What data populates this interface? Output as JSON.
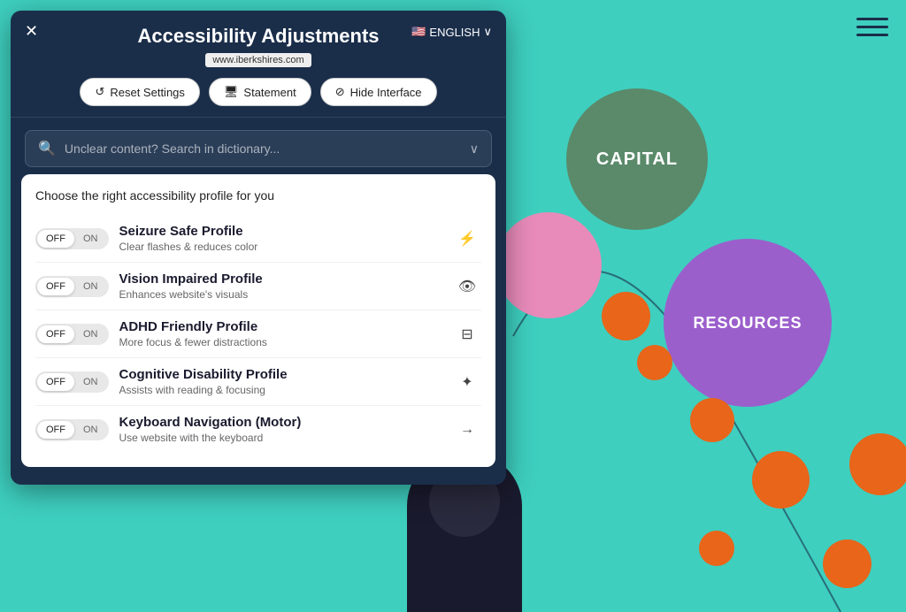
{
  "panel": {
    "title": "Accessibility Adjustments",
    "url": "www.iberkshires.com",
    "close_label": "✕",
    "language_label": "ENGLISH",
    "language_flag": "🇺🇸"
  },
  "action_buttons": {
    "reset": "Reset Settings",
    "statement": "Statement",
    "hide": "Hide Interface"
  },
  "search": {
    "placeholder": "Unclear content? Search in dictionary..."
  },
  "profile_section": {
    "heading": "Choose the right accessibility profile for you",
    "profiles": [
      {
        "name": "Seizure Safe Profile",
        "desc": "Clear flashes & reduces color",
        "icon": "⚡",
        "off_label": "OFF",
        "on_label": "ON",
        "active": "off"
      },
      {
        "name": "Vision Impaired Profile",
        "desc": "Enhances website's visuals",
        "icon": "👁",
        "off_label": "OFF",
        "on_label": "ON",
        "active": "off"
      },
      {
        "name": "ADHD Friendly Profile",
        "desc": "More focus & fewer distractions",
        "icon": "⊟",
        "off_label": "OFF",
        "on_label": "ON",
        "active": "off"
      },
      {
        "name": "Cognitive Disability Profile",
        "desc": "Assists with reading & focusing",
        "icon": "✦",
        "off_label": "OFF",
        "on_label": "ON",
        "active": "off"
      },
      {
        "name": "Keyboard Navigation (Motor)",
        "desc": "Use website with the keyboard",
        "icon": "→",
        "off_label": "OFF",
        "on_label": "ON",
        "active": "off"
      }
    ]
  },
  "background": {
    "circles": {
      "capital_label": "CAPITAL",
      "resources_label": "RESOURCES"
    }
  },
  "colors": {
    "bg_teal": "#3ecfbf",
    "panel_dark": "#1a2e4a",
    "circle_green": "#5a8a6a",
    "circle_purple": "#9b5fcc",
    "circle_pink": "#e88bba",
    "circle_orange": "#e8651a"
  }
}
